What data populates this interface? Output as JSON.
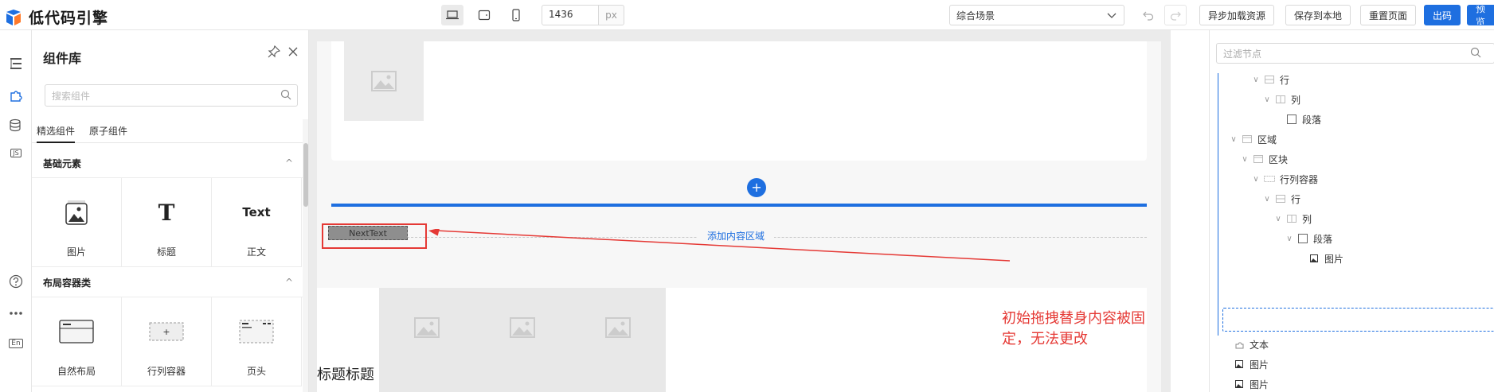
{
  "app": {
    "logo_text": "低代码引擎",
    "brand_color": "#1e6fe0"
  },
  "toolbar": {
    "devices": [
      "desktop-icon",
      "tablet-icon",
      "mobile-icon"
    ],
    "width_value": "1436",
    "width_unit": "px",
    "scene": "综合场景",
    "undo_icon": "undo-icon",
    "redo_icon": "redo-icon",
    "async_load_label": "异步加载资源",
    "save_local_label": "保存到本地",
    "reset_label": "重置页面",
    "code_label": "出码",
    "preview_label": "预览"
  },
  "rail": {
    "icons": [
      "outline-icon",
      "component-icon",
      "datasource-icon",
      "js-icon",
      "help-icon",
      "more-icon",
      "lang-icon"
    ],
    "js_text": "JS",
    "lang_text": "En"
  },
  "library": {
    "title": "组件库",
    "search_placeholder": "搜索组件",
    "tabs": [
      "精选组件",
      "原子组件"
    ],
    "categories": [
      {
        "name": "基础元素",
        "items": [
          {
            "label": "图片",
            "icon": "image-icon"
          },
          {
            "label": "标题",
            "icon": "title-icon",
            "glyph": "T"
          },
          {
            "label": "正文",
            "icon": "text-icon",
            "glyph": "Text"
          }
        ]
      },
      {
        "name": "布局容器类",
        "items": [
          {
            "label": "自然布局",
            "icon": "layout-icon"
          },
          {
            "label": "行列容器",
            "icon": "row-col-icon"
          },
          {
            "label": "页头",
            "icon": "page-header-icon"
          }
        ]
      }
    ]
  },
  "canvas": {
    "add_content_area": "添加内容区域",
    "drag_ghost_text": "NextText",
    "title_text": "标题标题",
    "annotation": "初始拖拽替身内容被固定，无法更改"
  },
  "outline": {
    "filter_placeholder": "过滤节点",
    "nodes": [
      {
        "label": "行",
        "level": 3,
        "expanded": true,
        "icon": "row-icon"
      },
      {
        "label": "列",
        "level": 4,
        "expanded": true,
        "icon": "col-icon"
      },
      {
        "label": "段落",
        "level": 5,
        "expanded": false,
        "icon": "paragraph-icon"
      },
      {
        "label": "区域",
        "level": 0,
        "expanded": true,
        "icon": "area-icon"
      },
      {
        "label": "区块",
        "level": 1,
        "expanded": true,
        "icon": "block-icon"
      },
      {
        "label": "行列容器",
        "level": 2,
        "expanded": true,
        "icon": "row-col-icon"
      },
      {
        "label": "行",
        "level": 3,
        "expanded": true,
        "icon": "row-icon"
      },
      {
        "label": "列",
        "level": 4,
        "expanded": true,
        "icon": "col-icon"
      },
      {
        "label": "段落",
        "level": 5,
        "expanded": true,
        "icon": "paragraph-icon"
      },
      {
        "label": "图片",
        "level": 6,
        "expanded": false,
        "icon": "image-icon"
      },
      {
        "label": "文本",
        "level": -1,
        "expanded": false,
        "icon": "text-icon"
      },
      {
        "label": "图片",
        "level": -1,
        "expanded": false,
        "icon": "image-icon"
      },
      {
        "label": "图片",
        "level": -1,
        "expanded": false,
        "icon": "image-icon"
      }
    ]
  }
}
